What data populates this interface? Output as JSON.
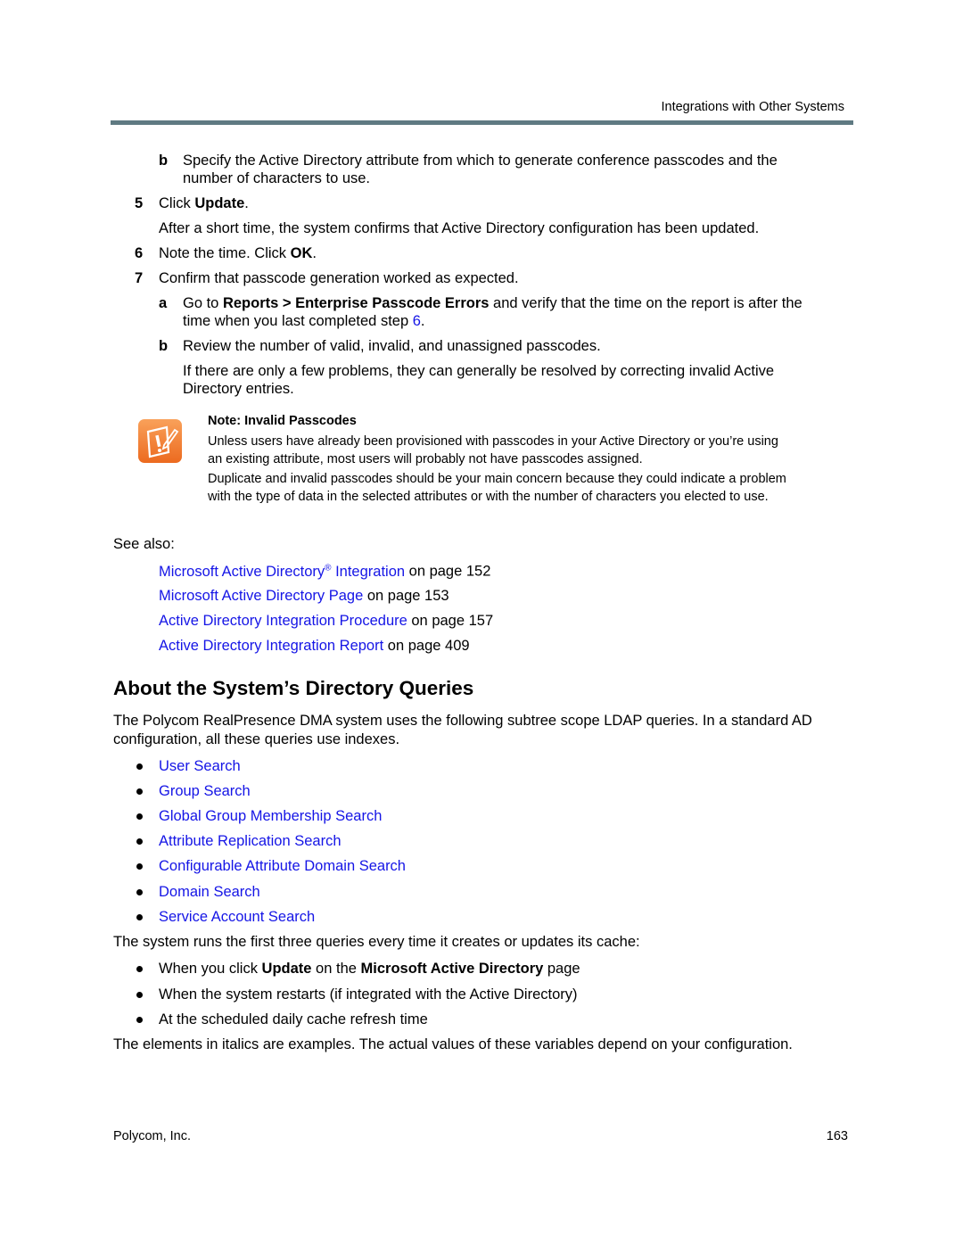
{
  "header": {
    "section_title": "Integrations with Other Systems"
  },
  "steps": {
    "b1": {
      "label": "b",
      "line1": "Specify the Active Directory attribute from which to generate conference passcodes and the",
      "line2": "number of characters to use."
    },
    "s5": {
      "num": "5",
      "pre": "Click ",
      "bold": "Update",
      "post": ".",
      "detail": "After a short time, the system confirms that Active Directory configuration has been updated."
    },
    "s6": {
      "num": "6",
      "pre": "Note the time. Click ",
      "bold": "OK",
      "post": "."
    },
    "s7": {
      "num": "7",
      "text": "Confirm that passcode generation worked as expected."
    },
    "a": {
      "label": "a",
      "pre": "Go to ",
      "bold": "Reports > Enterprise Passcode Errors",
      "post": " and verify that the time on the report is after the",
      "line2_pre": "time when you last completed step ",
      "line2_link": "6",
      "line2_post": "."
    },
    "b2": {
      "label": "b",
      "text": "Review the number of valid, invalid, and unassigned passcodes.",
      "para1": "If there are only a few problems, they can generally be resolved by correcting invalid Active",
      "para2": "Directory entries."
    }
  },
  "note": {
    "icon": "note-warning-icon",
    "title": "Note: Invalid Passcodes",
    "p1_l1": "Unless users have already been provisioned with passcodes in your Active Directory or you’re using",
    "p1_l2": "an existing attribute, most users will probably not have passcodes assigned.",
    "p2_l1": "Duplicate and invalid passcodes should be your main concern because they could indicate a problem",
    "p2_l2": "with the type of data in the selected attributes or with the number of characters you elected to use."
  },
  "see_also": {
    "label": "See also:",
    "items": [
      {
        "link_pre": "Microsoft Active Directory",
        "sup": "®",
        "link_post": " Integration",
        "suffix": " on page 152"
      },
      {
        "link": "Microsoft Active Directory Page",
        "suffix": " on page 153"
      },
      {
        "link": "Active Directory Integration Procedure",
        "suffix": " on page 157"
      },
      {
        "link": "Active Directory Integration Report",
        "suffix": " on page 409"
      }
    ]
  },
  "section": {
    "title": "About the System’s Directory Queries",
    "intro_l1": "The Polycom RealPresence DMA system uses the following subtree scope LDAP queries. In a standard AD",
    "intro_l2": "configuration, all these queries use indexes.",
    "queries": [
      "User Search",
      "Group Search",
      "Global Group Membership Search",
      "Attribute Replication Search",
      "Configurable Attribute Domain Search",
      "Domain Search",
      "Service Account Search"
    ],
    "cache_intro": "The system runs the first three queries every time it creates or updates its cache:",
    "cache_items": [
      {
        "pre": "When you click ",
        "b1": "Update",
        "mid": " on the ",
        "b2": "Microsoft Active Directory",
        "post": " page"
      },
      {
        "text": "When the system restarts (if integrated with the Active Directory)"
      },
      {
        "text": "At the scheduled daily cache refresh time"
      }
    ],
    "closing": "The elements in italics are examples. The actual values of these variables depend on your configuration."
  },
  "footer": {
    "company": "Polycom, Inc.",
    "page_number": "163"
  },
  "colors": {
    "link": "#1515e6",
    "rule": "#5f7a82",
    "note_icon": "#f07a2a"
  }
}
